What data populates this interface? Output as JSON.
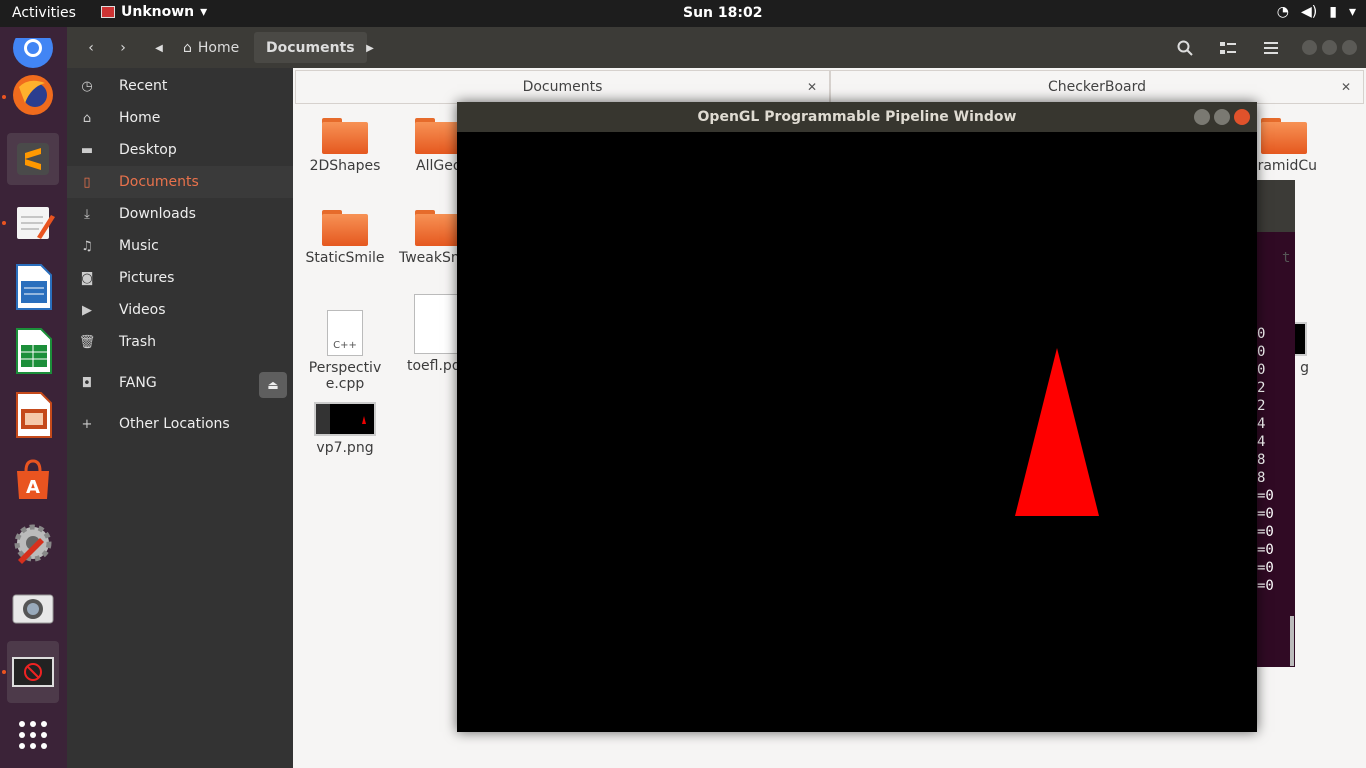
{
  "topbar": {
    "activities": "Activities",
    "app_name": "Unknown",
    "clock": "Sun 18:02",
    "tray_icons": [
      "wifi-icon",
      "volume-icon",
      "battery-icon",
      "power-icon"
    ]
  },
  "dock": {
    "apps": [
      "chrome-icon",
      "firefox-icon",
      "sublime-text-icon",
      "text-editor-icon",
      "libreoffice-writer-icon",
      "libreoffice-calc-icon",
      "libreoffice-impress-icon",
      "software-center-icon",
      "system-settings-icon",
      "camera-icon",
      "running-app-icon",
      "show-applications-icon"
    ]
  },
  "files": {
    "breadcrumb": {
      "home": "Home",
      "current": "Documents"
    },
    "sidebar": [
      {
        "label": "Recent",
        "icon": "clock-icon"
      },
      {
        "label": "Home",
        "icon": "home-icon"
      },
      {
        "label": "Desktop",
        "icon": "folder-icon"
      },
      {
        "label": "Documents",
        "icon": "document-icon",
        "selected": true
      },
      {
        "label": "Downloads",
        "icon": "download-icon"
      },
      {
        "label": "Music",
        "icon": "music-icon"
      },
      {
        "label": "Pictures",
        "icon": "camera-icon"
      },
      {
        "label": "Videos",
        "icon": "video-icon"
      },
      {
        "label": "Trash",
        "icon": "trash-icon"
      },
      {
        "label": "FANG",
        "icon": "drive-icon"
      },
      {
        "label": "Other Locations",
        "icon": "plus-icon"
      }
    ],
    "tabs": [
      {
        "label": "Documents"
      },
      {
        "label": "CheckerBoard"
      }
    ],
    "items": [
      {
        "label": "2DShapes",
        "type": "folder"
      },
      {
        "label": "AllGeo",
        "type": "folder"
      },
      {
        "label": "StaticSmile",
        "type": "folder"
      },
      {
        "label": "TweakSm",
        "type": "folder"
      },
      {
        "label": "Perspective.cpp",
        "type": "cpp",
        "badge": "C++"
      },
      {
        "label": "toefl.pd",
        "type": "pdf"
      },
      {
        "label": "vp7.png",
        "type": "image"
      },
      {
        "label": "ramidCu",
        "type": "folder"
      },
      {
        "label": "g",
        "type": "image"
      }
    ]
  },
  "terminal": {
    "lines": [
      "t",
      "0",
      "0",
      "0",
      "2",
      "2",
      "4",
      "4",
      "8",
      "8",
      "=0",
      "=0",
      "=0",
      "=0",
      "=0",
      "=0"
    ]
  },
  "opengl_window": {
    "title": "OpenGL Programmable Pipeline Window",
    "triangle_color": "#ff0000",
    "background_color": "#000000"
  }
}
